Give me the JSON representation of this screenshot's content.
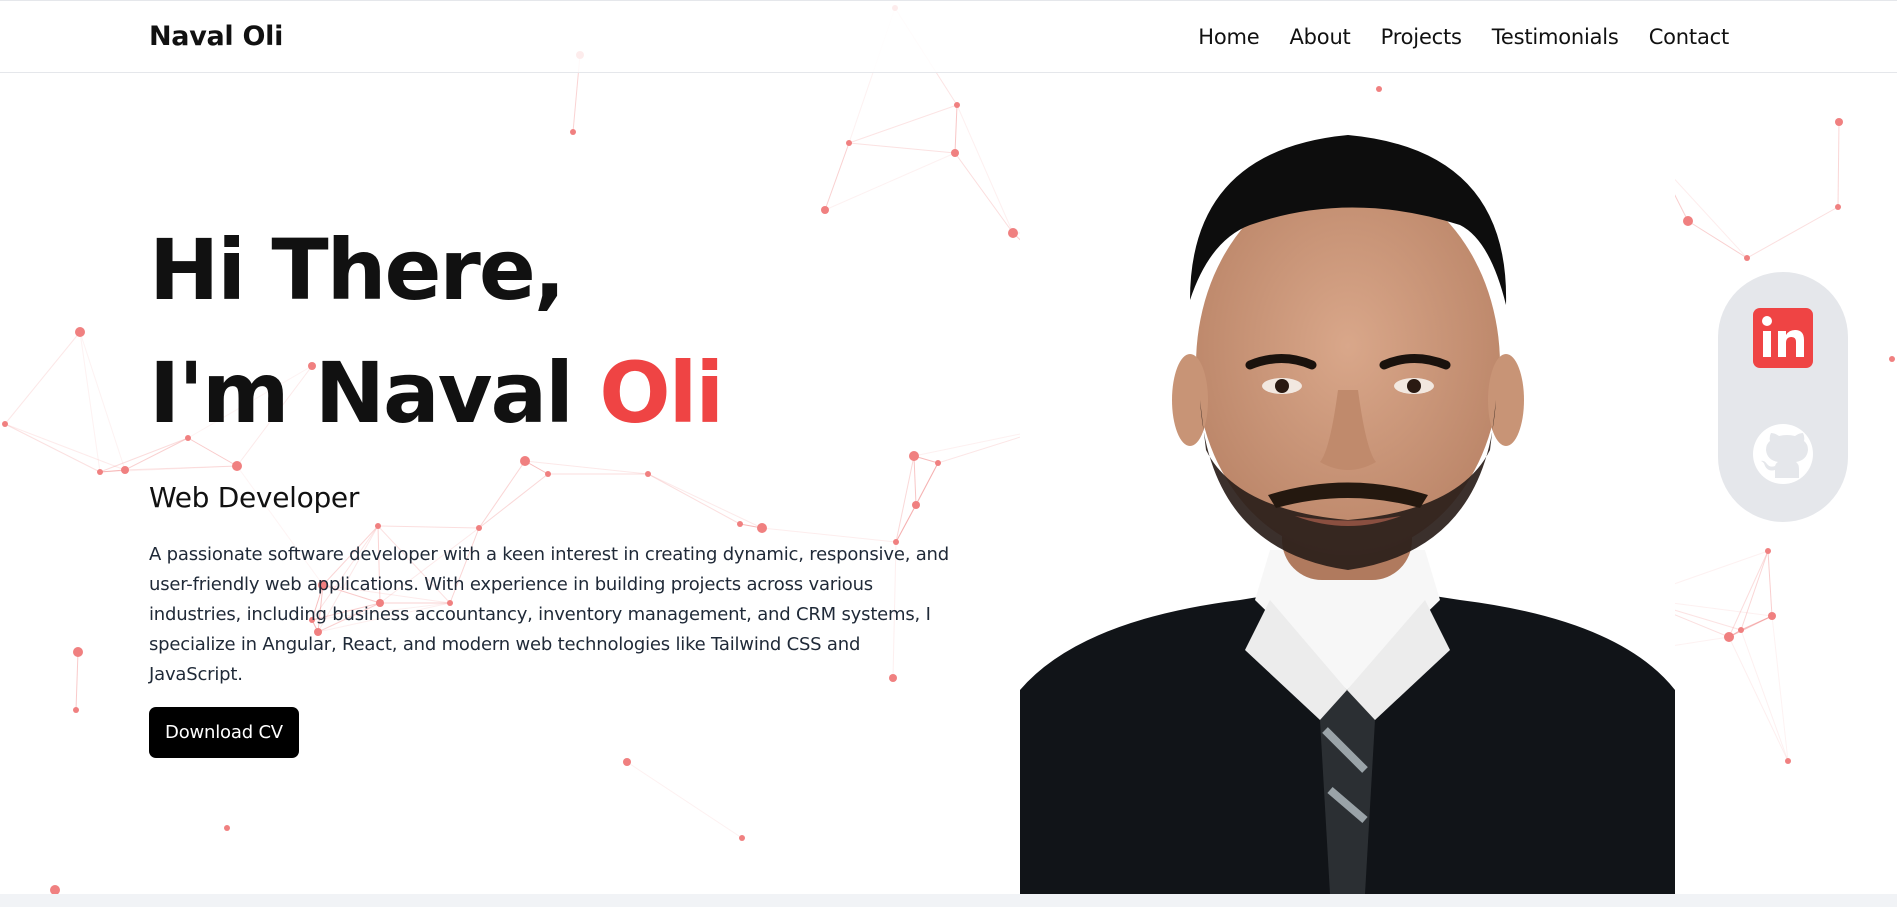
{
  "brand": {
    "name": "Naval Oli"
  },
  "nav": {
    "home": "Home",
    "about": "About",
    "projects": "Projects",
    "testimonials": "Testimonials",
    "contact": "Contact"
  },
  "hero": {
    "greeting": "Hi There,",
    "intro_prefix": "I'm Naval ",
    "intro_accent": "Oli",
    "role": "Web Developer",
    "bio": "A passionate software developer with a keen interest in creating dynamic, responsive, and user-friendly web applications. With experience in building projects across various industries, including business accountancy, inventory management, and CRM systems, I specialize in Angular, React, and modern web technologies like Tailwind CSS and JavaScript.",
    "cta_label": "Download CV"
  },
  "social": {
    "linkedin_icon": "linkedin-icon",
    "github_icon": "github-icon"
  },
  "colors": {
    "accent": "#ef4444",
    "text": "#111111",
    "pill_bg": "#e5e7eb",
    "button_bg": "#000000",
    "network": "#f08080"
  }
}
